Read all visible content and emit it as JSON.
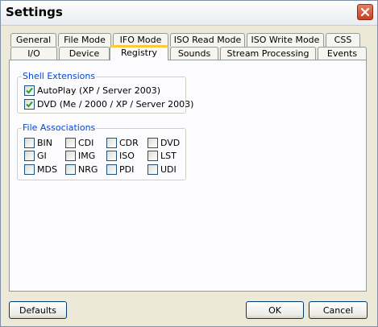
{
  "window": {
    "title": "Settings"
  },
  "tabs": {
    "row_top": [
      "General",
      "File Mode",
      "IFO Mode",
      "ISO Read Mode",
      "ISO Write Mode",
      "CSS"
    ],
    "row_bottom": [
      "I/O",
      "Device",
      "Registry",
      "Sounds",
      "Stream Processing",
      "Events"
    ],
    "active": "Registry"
  },
  "shell_extensions": {
    "label": "Shell Extensions",
    "items": [
      {
        "label": "AutoPlay (XP / Server 2003)",
        "checked": true
      },
      {
        "label": "DVD (Me / 2000 / XP / Server 2003)",
        "checked": true
      }
    ]
  },
  "file_associations": {
    "label": "File Associations",
    "items": [
      {
        "label": "BIN",
        "checked": false
      },
      {
        "label": "CDI",
        "checked": false
      },
      {
        "label": "CDR",
        "checked": false
      },
      {
        "label": "DVD",
        "checked": false
      },
      {
        "label": "GI",
        "checked": false
      },
      {
        "label": "IMG",
        "checked": false
      },
      {
        "label": "ISO",
        "checked": false
      },
      {
        "label": "LST",
        "checked": false
      },
      {
        "label": "MDS",
        "checked": false
      },
      {
        "label": "NRG",
        "checked": false
      },
      {
        "label": "PDI",
        "checked": false
      },
      {
        "label": "UDI",
        "checked": false
      }
    ]
  },
  "buttons": {
    "defaults": "Defaults",
    "ok": "OK",
    "cancel": "Cancel"
  },
  "colors": {
    "group_label": "#0046d5",
    "active_tab_accent": "#ffc83c",
    "check_mark": "#21a121"
  },
  "icons": {
    "close": "close-icon",
    "check": "check-icon"
  }
}
